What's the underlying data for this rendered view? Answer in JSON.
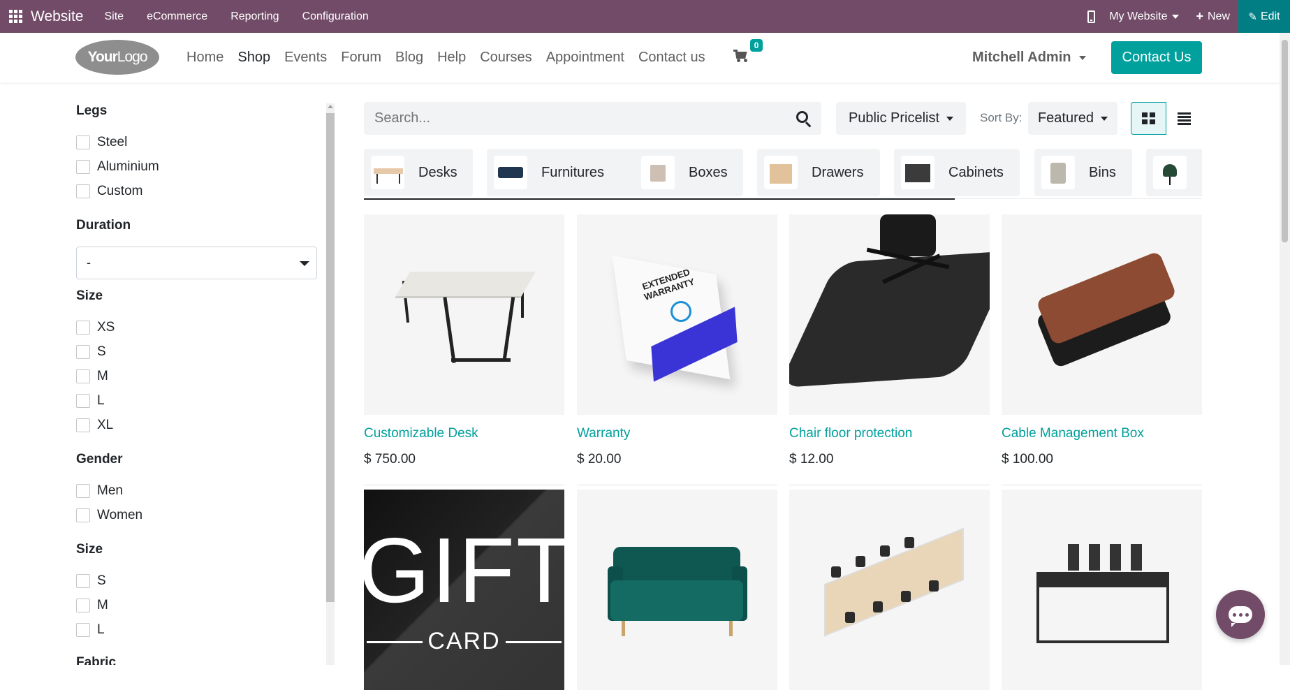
{
  "admin_bar": {
    "brand": "Website",
    "menu": [
      "Site",
      "eCommerce",
      "Reporting",
      "Configuration"
    ],
    "website_switcher": "My Website",
    "new_label": "New",
    "edit_label": "Edit",
    "color": "#714b67",
    "edit_color": "#017e84"
  },
  "header": {
    "logo_text_bold": "Your",
    "logo_text": "Logo",
    "nav": [
      "Home",
      "Shop",
      "Events",
      "Forum",
      "Blog",
      "Help",
      "Courses",
      "Appointment",
      "Contact us"
    ],
    "active_nav": "Shop",
    "cart_count": "0",
    "user": "Mitchell Admin",
    "contact_button": "Contact Us",
    "accent_color": "#00a09d"
  },
  "filters": {
    "legs": {
      "title": "Legs",
      "options": [
        "Steel",
        "Aluminium",
        "Custom"
      ]
    },
    "duration": {
      "title": "Duration",
      "selected": "-"
    },
    "size": {
      "title": "Size",
      "options": [
        "XS",
        "S",
        "M",
        "L",
        "XL"
      ]
    },
    "gender": {
      "title": "Gender",
      "options": [
        "Men",
        "Women"
      ]
    },
    "size2": {
      "title": "Size",
      "options": [
        "S",
        "M",
        "L"
      ]
    },
    "fabric": {
      "title": "Fabric"
    }
  },
  "toolbar": {
    "search_placeholder": "Search...",
    "pricelist": "Public Pricelist",
    "sort_label": "Sort By:",
    "sort_value": "Featured",
    "view": "grid"
  },
  "categories": [
    "Desks",
    "Furnitures",
    "Boxes",
    "Drawers",
    "Cabinets",
    "Bins"
  ],
  "products": [
    {
      "name": "Customizable Desk",
      "price": "$ 750.00"
    },
    {
      "name": "Warranty",
      "price": "$ 20.00"
    },
    {
      "name": "Chair floor protection",
      "price": "$ 12.00"
    },
    {
      "name": "Cable Management Box",
      "price": "$ 100.00"
    }
  ],
  "gift_card": {
    "line1": "GIFT",
    "line2": "CARD"
  },
  "warranty_box_text": "EXTENDED WARRANTY",
  "chat": {
    "icon": "chat-bubble-icon"
  }
}
